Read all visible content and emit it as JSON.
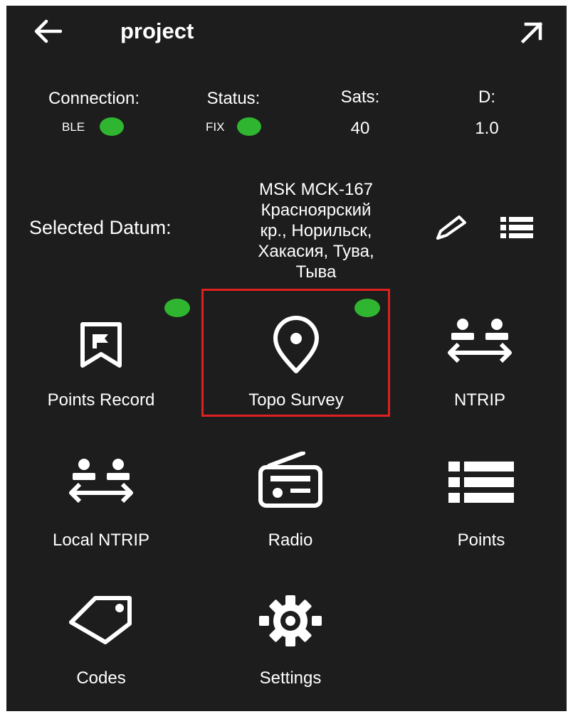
{
  "header": {
    "title": "project",
    "back_icon": "arrow-left-icon",
    "expand_icon": "arrow-up-right-icon"
  },
  "status": {
    "connection": {
      "label": "Connection:",
      "value": "BLE"
    },
    "status": {
      "label": "Status:",
      "value": "FIX"
    },
    "sats": {
      "label": "Sats:",
      "value": "40"
    },
    "d": {
      "label": "D:",
      "value": "1.0"
    }
  },
  "datum": {
    "label": "Selected Datum:",
    "line1": "MSK MCK-167",
    "line2": "Красноярский",
    "line3": "кр., Норильск,",
    "line4": "Хакасия, Тува,",
    "line5": "Тыва"
  },
  "menu": {
    "points_record": "Points Record",
    "topo_survey": "Topo Survey",
    "ntrip": "NTRIP",
    "local_ntrip": "Local NTRIP",
    "radio": "Radio",
    "points": "Points",
    "codes": "Codes",
    "settings": "Settings"
  },
  "colors": {
    "background": "#1d1d1d",
    "indicator": "#2fb52f",
    "highlight": "#e02020",
    "text": "#ffffff"
  }
}
